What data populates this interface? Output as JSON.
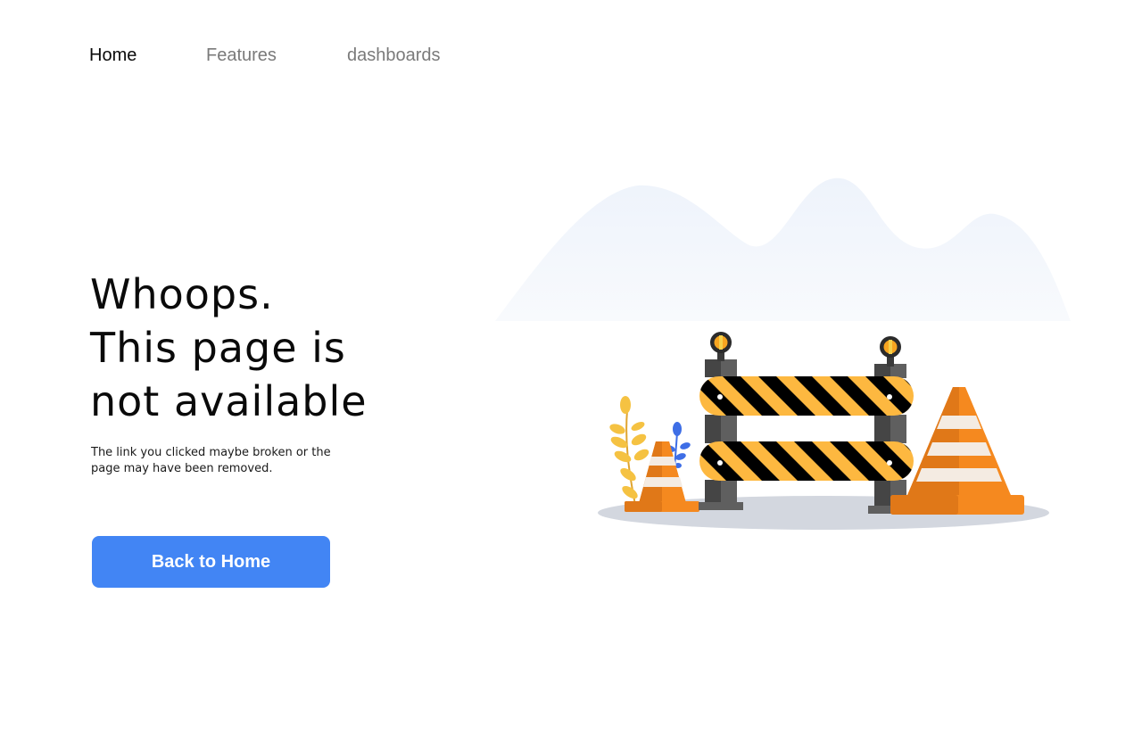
{
  "nav": {
    "items": [
      {
        "label": "Home"
      },
      {
        "label": "Features"
      },
      {
        "label": "dashboards"
      }
    ]
  },
  "hero": {
    "title_lines": [
      "Whoops.",
      "This page is",
      "not available"
    ],
    "description": "The link you clicked maybe broken or the page may have been removed.",
    "button_label": "Back to Home"
  },
  "colors": {
    "accent": "#4285f4",
    "nav_active": "#0a0a0a",
    "nav_inactive": "#7a7a7a",
    "stripe_yellow": "#fdb840",
    "cone_orange": "#f5891f"
  },
  "illustration": {
    "icon": "road-barrier-construction-icon"
  }
}
